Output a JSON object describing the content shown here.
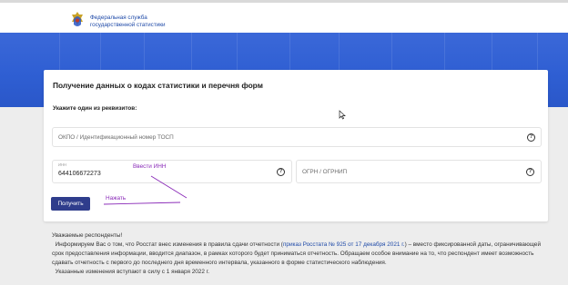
{
  "header": {
    "org_line1": "Федеральная служба",
    "org_line2": "государственной статистики",
    "logo_icon": "emblem-icon"
  },
  "card": {
    "title": "Получение данных о кодах статистики и перечня форм",
    "prompt": "Укажите один из реквизитов:",
    "okpo_placeholder": "ОКПО / Идентификационный номер ТОСП",
    "inn_label": "ИНН",
    "inn_value": "644106672273",
    "ogrn_placeholder": "ОГРН / ОГРНИП",
    "help_glyph": "?",
    "submit_label": "Получить"
  },
  "annotations": {
    "inn_note": "Ввести ИНН",
    "click_note": "Нажать",
    "color": "#8a2bb8"
  },
  "notice": {
    "greeting": "Уважаемые респонденты!",
    "p1_before": "Информируем Вас о том, что Росстат внес изменения в правила сдачи отчетности (",
    "p1_link": "приказ Росстата № 925 от 17 декабря 2021 г.",
    "p1_after": ") – вместо фиксированной даты, ограничивающей срок предоставления информации, вводится диапазон, в рамках которого будет приниматься отчетность. Обращаем особое внимание на то, что респондент имеет возможность сдавать отчетность с первого до последнего дня временного интервала, указанного в форме статистического наблюдения.",
    "p2": "Указанные изменения вступают в силу с 1 января 2022 г."
  },
  "colors": {
    "banner": "#2f5fd3",
    "button": "#2f3d8c",
    "link": "#1f4aa8"
  }
}
